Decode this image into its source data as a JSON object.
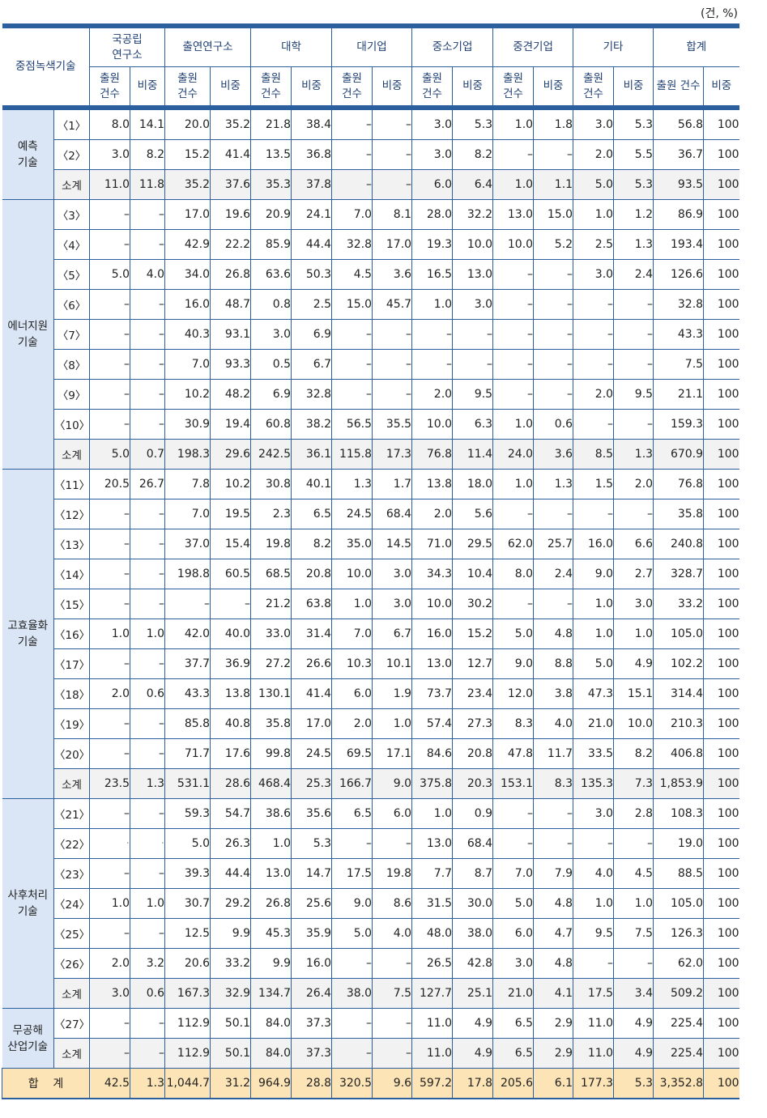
{
  "unit_label": "(건, %)",
  "header": {
    "category_label": "중점녹색기술",
    "groups": [
      "국공립\n연구소",
      "출연연구소",
      "대학",
      "대기업",
      "중소기업",
      "중견기업",
      "기타",
      "합계"
    ],
    "count_label": "출원\n건수",
    "share_label": "비중",
    "total_count_label": "출원 건수"
  },
  "sections": [
    {
      "category": "예측\n기술",
      "rows": [
        {
          "item": "〈1〉",
          "values": [
            "8.0",
            "14.1",
            "20.0",
            "35.2",
            "21.8",
            "38.4",
            "–",
            "–",
            "3.0",
            "5.3",
            "1.0",
            "1.8",
            "3.0",
            "5.3",
            "56.8",
            "100"
          ]
        },
        {
          "item": "〈2〉",
          "values": [
            "3.0",
            "8.2",
            "15.2",
            "41.4",
            "13.5",
            "36.8",
            "–",
            "–",
            "3.0",
            "8.2",
            "–",
            "–",
            "2.0",
            "5.5",
            "36.7",
            "100"
          ]
        },
        {
          "item": "소계",
          "subtotal": true,
          "values": [
            "11.0",
            "11.8",
            "35.2",
            "37.6",
            "35.3",
            "37.8",
            "–",
            "–",
            "6.0",
            "6.4",
            "1.0",
            "1.1",
            "5.0",
            "5.3",
            "93.5",
            "100"
          ]
        }
      ]
    },
    {
      "category": "에너지원\n기술",
      "rows": [
        {
          "item": "〈3〉",
          "values": [
            "–",
            "–",
            "17.0",
            "19.6",
            "20.9",
            "24.1",
            "7.0",
            "8.1",
            "28.0",
            "32.2",
            "13.0",
            "15.0",
            "1.0",
            "1.2",
            "86.9",
            "100"
          ]
        },
        {
          "item": "〈4〉",
          "values": [
            "–",
            "–",
            "42.9",
            "22.2",
            "85.9",
            "44.4",
            "32.8",
            "17.0",
            "19.3",
            "10.0",
            "10.0",
            "5.2",
            "2.5",
            "1.3",
            "193.4",
            "100"
          ]
        },
        {
          "item": "〈5〉",
          "values": [
            "5.0",
            "4.0",
            "34.0",
            "26.8",
            "63.6",
            "50.3",
            "4.5",
            "3.6",
            "16.5",
            "13.0",
            "–",
            "–",
            "3.0",
            "2.4",
            "126.6",
            "100"
          ]
        },
        {
          "item": "〈6〉",
          "values": [
            "–",
            "–",
            "16.0",
            "48.7",
            "0.8",
            "2.5",
            "15.0",
            "45.7",
            "1.0",
            "3.0",
            "–",
            "–",
            "–",
            "–",
            "32.8",
            "100"
          ]
        },
        {
          "item": "〈7〉",
          "values": [
            "–",
            "–",
            "40.3",
            "93.1",
            "3.0",
            "6.9",
            "–",
            "–",
            "–",
            "–",
            "–",
            "–",
            "–",
            "–",
            "43.3",
            "100"
          ]
        },
        {
          "item": "〈8〉",
          "values": [
            "–",
            "–",
            "7.0",
            "93.3",
            "0.5",
            "6.7",
            "–",
            "–",
            "–",
            "–",
            "–",
            "–",
            "–",
            "–",
            "7.5",
            "100"
          ]
        },
        {
          "item": "〈9〉",
          "values": [
            "–",
            "–",
            "10.2",
            "48.2",
            "6.9",
            "32.8",
            "–",
            "–",
            "2.0",
            "9.5",
            "–",
            "–",
            "2.0",
            "9.5",
            "21.1",
            "100"
          ]
        },
        {
          "item": "〈10〉",
          "values": [
            "–",
            "–",
            "30.9",
            "19.4",
            "60.8",
            "38.2",
            "56.5",
            "35.5",
            "10.0",
            "6.3",
            "1.0",
            "0.6",
            "–",
            "–",
            "159.3",
            "100"
          ]
        },
        {
          "item": "소계",
          "subtotal": true,
          "values": [
            "5.0",
            "0.7",
            "198.3",
            "29.6",
            "242.5",
            "36.1",
            "115.8",
            "17.3",
            "76.8",
            "11.4",
            "24.0",
            "3.6",
            "8.5",
            "1.3",
            "670.9",
            "100"
          ]
        }
      ]
    },
    {
      "category": "고효율화\n기술",
      "rows": [
        {
          "item": "〈11〉",
          "values": [
            "20.5",
            "26.7",
            "7.8",
            "10.2",
            "30.8",
            "40.1",
            "1.3",
            "1.7",
            "13.8",
            "18.0",
            "1.0",
            "1.3",
            "1.5",
            "2.0",
            "76.8",
            "100"
          ]
        },
        {
          "item": "〈12〉",
          "values": [
            "–",
            "–",
            "7.0",
            "19.5",
            "2.3",
            "6.5",
            "24.5",
            "68.4",
            "2.0",
            "5.6",
            "–",
            "–",
            "–",
            "–",
            "35.8",
            "100"
          ]
        },
        {
          "item": "〈13〉",
          "values": [
            "–",
            "–",
            "37.0",
            "15.4",
            "19.8",
            "8.2",
            "35.0",
            "14.5",
            "71.0",
            "29.5",
            "62.0",
            "25.7",
            "16.0",
            "6.6",
            "240.8",
            "100"
          ]
        },
        {
          "item": "〈14〉",
          "values": [
            "–",
            "–",
            "198.8",
            "60.5",
            "68.5",
            "20.8",
            "10.0",
            "3.0",
            "34.3",
            "10.4",
            "8.0",
            "2.4",
            "9.0",
            "2.7",
            "328.7",
            "100"
          ]
        },
        {
          "item": "〈15〉",
          "values": [
            "–",
            "–",
            "–",
            "–",
            "21.2",
            "63.8",
            "1.0",
            "3.0",
            "10.0",
            "30.2",
            "–",
            "–",
            "1.0",
            "3.0",
            "33.2",
            "100"
          ]
        },
        {
          "item": "〈16〉",
          "values": [
            "1.0",
            "1.0",
            "42.0",
            "40.0",
            "33.0",
            "31.4",
            "7.0",
            "6.7",
            "16.0",
            "15.2",
            "5.0",
            "4.8",
            "1.0",
            "1.0",
            "105.0",
            "100"
          ]
        },
        {
          "item": "〈17〉",
          "values": [
            "–",
            "–",
            "37.7",
            "36.9",
            "27.2",
            "26.6",
            "10.3",
            "10.1",
            "13.0",
            "12.7",
            "9.0",
            "8.8",
            "5.0",
            "4.9",
            "102.2",
            "100"
          ]
        },
        {
          "item": "〈18〉",
          "values": [
            "2.0",
            "0.6",
            "43.3",
            "13.8",
            "130.1",
            "41.4",
            "6.0",
            "1.9",
            "73.7",
            "23.4",
            "12.0",
            "3.8",
            "47.3",
            "15.1",
            "314.4",
            "100"
          ]
        },
        {
          "item": "〈19〉",
          "values": [
            "–",
            "–",
            "85.8",
            "40.8",
            "35.8",
            "17.0",
            "2.0",
            "1.0",
            "57.4",
            "27.3",
            "8.3",
            "4.0",
            "21.0",
            "10.0",
            "210.3",
            "100"
          ]
        },
        {
          "item": "〈20〉",
          "values": [
            "–",
            "–",
            "71.7",
            "17.6",
            "99.8",
            "24.5",
            "69.5",
            "17.1",
            "84.6",
            "20.8",
            "47.8",
            "11.7",
            "33.5",
            "8.2",
            "406.8",
            "100"
          ]
        },
        {
          "item": "소계",
          "subtotal": true,
          "values": [
            "23.5",
            "1.3",
            "531.1",
            "28.6",
            "468.4",
            "25.3",
            "166.7",
            "9.0",
            "375.8",
            "20.3",
            "153.1",
            "8.3",
            "135.3",
            "7.3",
            "1,853.9",
            "100"
          ]
        }
      ]
    },
    {
      "category": "사후처리\n기술",
      "rows": [
        {
          "item": "〈21〉",
          "values": [
            "–",
            "–",
            "59.3",
            "54.7",
            "38.6",
            "35.6",
            "6.5",
            "6.0",
            "1.0",
            "0.9",
            "–",
            "–",
            "3.0",
            "2.8",
            "108.3",
            "100"
          ]
        },
        {
          "item": "〈22〉",
          "values": [
            "·",
            "·",
            "5.0",
            "26.3",
            "1.0",
            "5.3",
            "–",
            "–",
            "13.0",
            "68.4",
            "–",
            "–",
            "–",
            "–",
            "19.0",
            "100"
          ]
        },
        {
          "item": "〈23〉",
          "values": [
            "–",
            "–",
            "39.3",
            "44.4",
            "13.0",
            "14.7",
            "17.5",
            "19.8",
            "7.7",
            "8.7",
            "7.0",
            "7.9",
            "4.0",
            "4.5",
            "88.5",
            "100"
          ]
        },
        {
          "item": "〈24〉",
          "values": [
            "1.0",
            "1.0",
            "30.7",
            "29.2",
            "26.8",
            "25.6",
            "9.0",
            "8.6",
            "31.5",
            "30.0",
            "5.0",
            "4.8",
            "1.0",
            "1.0",
            "105.0",
            "100"
          ]
        },
        {
          "item": "〈25〉",
          "values": [
            "–",
            "–",
            "12.5",
            "9.9",
            "45.3",
            "35.9",
            "5.0",
            "4.0",
            "48.0",
            "38.0",
            "6.0",
            "4.7",
            "9.5",
            "7.5",
            "126.3",
            "100"
          ]
        },
        {
          "item": "〈26〉",
          "values": [
            "2.0",
            "3.2",
            "20.6",
            "33.2",
            "9.9",
            "16.0",
            "–",
            "–",
            "26.5",
            "42.8",
            "3.0",
            "4.8",
            "–",
            "–",
            "62.0",
            "100"
          ]
        },
        {
          "item": "소계",
          "subtotal": true,
          "values": [
            "3.0",
            "0.6",
            "167.3",
            "32.9",
            "134.7",
            "26.4",
            "38.0",
            "7.5",
            "127.7",
            "25.1",
            "21.0",
            "4.1",
            "17.5",
            "3.4",
            "509.2",
            "100"
          ]
        }
      ]
    },
    {
      "category": "무공해\n산업기술",
      "rows": [
        {
          "item": "〈27〉",
          "values": [
            "–",
            "–",
            "112.9",
            "50.1",
            "84.0",
            "37.3",
            "–",
            "–",
            "11.0",
            "4.9",
            "6.5",
            "2.9",
            "11.0",
            "4.9",
            "225.4",
            "100"
          ]
        },
        {
          "item": "소계",
          "subtotal": true,
          "values": [
            "–",
            "–",
            "112.9",
            "50.1",
            "84.0",
            "37.3",
            "–",
            "–",
            "11.0",
            "4.9",
            "6.5",
            "2.9",
            "11.0",
            "4.9",
            "225.4",
            "100"
          ]
        }
      ]
    }
  ],
  "total": {
    "label": "합    계",
    "values": [
      "42.5",
      "1.3",
      "1,044.7",
      "31.2",
      "964.9",
      "28.8",
      "320.5",
      "9.6",
      "597.2",
      "17.8",
      "205.6",
      "6.1",
      "177.3",
      "5.3",
      "3,352.8",
      "100"
    ]
  },
  "colors": {
    "border": "#2c5f9e",
    "category_bg": "#dae6f5",
    "subtotal_bg": "#f2f2f2",
    "total_bg": "#fde4b6",
    "header_text": "#1f3f73"
  }
}
